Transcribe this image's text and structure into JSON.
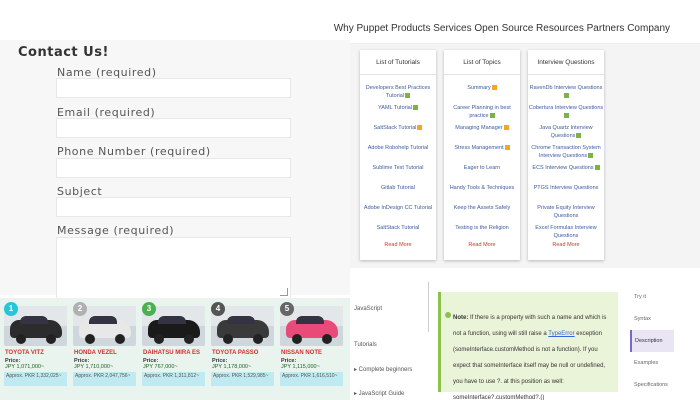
{
  "header": {
    "nav_text": "Why Puppet Products Services Open Source Resources Partners Company"
  },
  "contact": {
    "title": "Contact Us!",
    "name_label": "Name (required)",
    "email_label": "Email (required)",
    "phone_label": "Phone Number (required)",
    "subject_label": "Subject",
    "message_label": "Message (required)"
  },
  "cars": [
    {
      "rank": "1",
      "name": "TOYOTA VITZ",
      "price_label": "Price:",
      "price": "JPY 1,071,000~",
      "approx": "Approx. PKR 1,332,025~",
      "color": "#2c2c2c",
      "badge": "#26c6da"
    },
    {
      "rank": "2",
      "name": "HONDA VEZEL",
      "price_label": "Price:",
      "price": "JPY 1,710,000~",
      "approx": "Approx. PKR 2,047,756~",
      "color": "#e8e8e8",
      "badge": "#b0b0b0"
    },
    {
      "rank": "3",
      "name": "DAIHATSU MIRA ES",
      "price_label": "Price:",
      "price": "JPY 767,000~",
      "approx": "Approx. PKR 1,311,812~",
      "color": "#1a1a1a",
      "badge": "#4caf50"
    },
    {
      "rank": "4",
      "name": "TOYOTA PASSO",
      "price_label": "Price:",
      "price": "JPY 1,178,000~",
      "approx": "Approx. PKR 1,529,985~",
      "color": "#3a3a3a",
      "badge": "#555555"
    },
    {
      "rank": "5",
      "name": "NISSAN NOTE",
      "price_label": "Price:",
      "price": "JPY 1,115,000~",
      "approx": "Approx. PKR 1,616,510~",
      "color": "#e84a7a",
      "badge": "#666666"
    }
  ],
  "cards": [
    {
      "title": "List of Tutorials",
      "items": [
        {
          "text": "Developers Best Practices Tutorial",
          "tag": "g"
        },
        {
          "text": "YAML Tutorial",
          "tag": "g"
        },
        {
          "text": "SaltStack Tutorial",
          "tag": "o"
        },
        {
          "text": "Adobe Robohelp Tutorial",
          "tag": ""
        },
        {
          "text": "Sublime Text Tutorial",
          "tag": ""
        },
        {
          "text": "Gitlab Tutorial",
          "tag": ""
        },
        {
          "text": "Adobe InDesign CC Tutorial",
          "tag": ""
        },
        {
          "text": "SaltStack Tutorial",
          "tag": ""
        }
      ],
      "more": "Read More"
    },
    {
      "title": "List of Topics",
      "items": [
        {
          "text": "Summary",
          "tag": "o"
        },
        {
          "text": "Career Planning in best practice",
          "tag": "g"
        },
        {
          "text": "Managing Manager",
          "tag": "o"
        },
        {
          "text": "Stress Management",
          "tag": "o"
        },
        {
          "text": "Eager to Learn",
          "tag": ""
        },
        {
          "text": "Handy Tools & Techniques",
          "tag": ""
        },
        {
          "text": "Keep the Assets Safely",
          "tag": ""
        },
        {
          "text": "Testing is the Religion",
          "tag": ""
        }
      ],
      "more": "Read More"
    },
    {
      "title": "Interview Questions",
      "items": [
        {
          "text": "RavenDb Interview Questions",
          "tag": "g"
        },
        {
          "text": "Cobertura Interview Questions",
          "tag": "g"
        },
        {
          "text": "Java Quartz Interview Questions",
          "tag": "g"
        },
        {
          "text": "Chrome Transaction System Interview Questions",
          "tag": "g"
        },
        {
          "text": "ECS Interview Questions",
          "tag": "g"
        },
        {
          "text": "PTGS Interview Questions",
          "tag": ""
        },
        {
          "text": "Private Equity Interview Questions",
          "tag": ""
        },
        {
          "text": "Excel Formulas Interview Questions",
          "tag": ""
        }
      ],
      "more": "Read More"
    }
  ],
  "panel": {
    "left_items": [
      "JavaScript",
      "Tutorials",
      "▸ Complete beginners",
      "▸ JavaScript Guide"
    ],
    "note_prefix": "Note:",
    "note_text_1": " If there is a property with such a name and which is not a function, using ",
    "note_text_2": " will still raise a ",
    "note_link": "TypeError",
    "note_text_3": " exception (someInterface.customMethod is not a function). If you expect that someInterface itself may be null or undefined, you have to use ?. at this position as well: someInterface?.customMethod?.()",
    "side_items": [
      "Try it",
      "Syntax",
      "Description",
      "Examples",
      "Specifications"
    ]
  }
}
